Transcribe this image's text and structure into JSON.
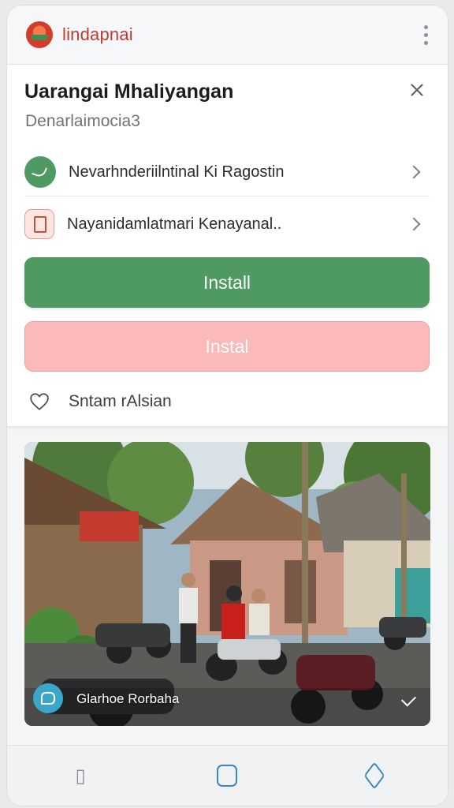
{
  "app": {
    "name": "lindapnai"
  },
  "dialog": {
    "title": "Uarangai Mhaliyangan",
    "subtitle": "Denarlaimocia3",
    "rows": [
      {
        "label": "Nevarhnderiilntinal Ki Ragostin",
        "icon": "chat-icon"
      },
      {
        "label": "Nayanidamlatmari Kenayanal..",
        "icon": "document-icon"
      }
    ],
    "primary_button": "Install",
    "secondary_button": "Instal",
    "favorite_label": "Sntam rAlsian"
  },
  "photo": {
    "caption": "Glarhoe Rorbaha",
    "avatar_icon": "chat-bubble-icon",
    "check_icon": "check-icon"
  },
  "colors": {
    "accent_green": "#4e9a62",
    "accent_pink": "#fbb9b9",
    "brand_red": "#c4392f",
    "nav_blue": "#3a87c7"
  },
  "nav": {
    "back": "back-icon",
    "home": "home-icon",
    "recent": "recents-icon"
  }
}
